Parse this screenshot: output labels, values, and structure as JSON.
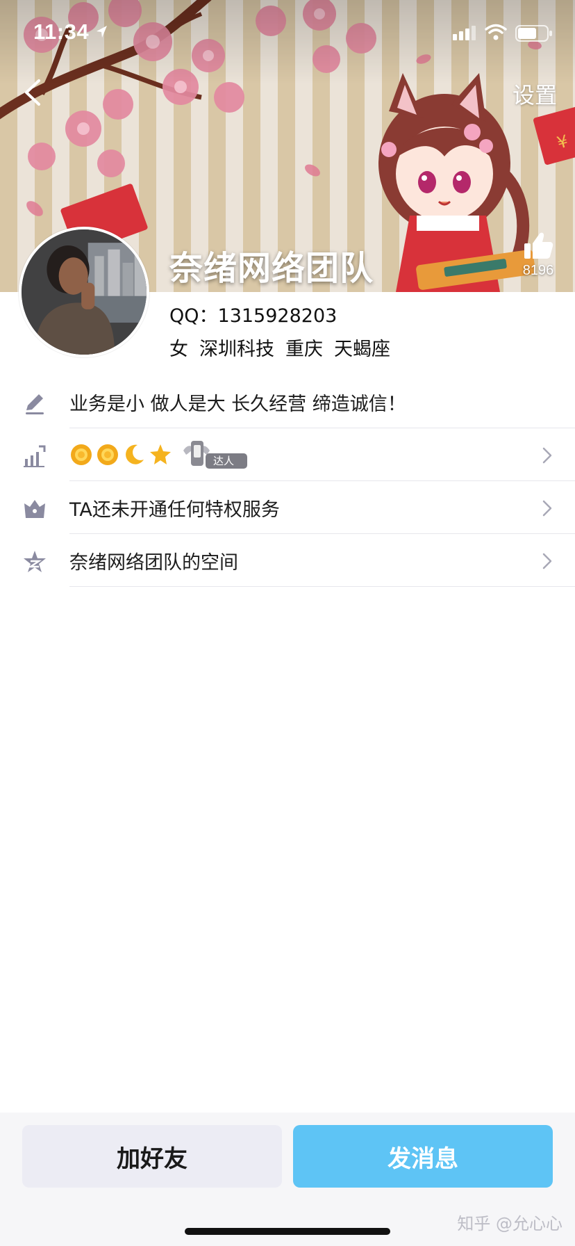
{
  "status_bar": {
    "time": "11:34",
    "icons": [
      "location-arrow-icon",
      "cellular-signal-icon",
      "wifi-icon",
      "battery-icon"
    ]
  },
  "nav": {
    "back_icon": "chevron-left-icon",
    "settings_label": "设置"
  },
  "profile": {
    "name": "奈绪网络团队",
    "like_count": "8196",
    "qq_label": "QQ：",
    "qq_number": "1315928203",
    "tags": [
      "女",
      "深圳科技",
      "重庆",
      "天蝎座"
    ]
  },
  "rows": [
    {
      "icon": "pencil-icon",
      "text": "业务是小 做人是大 长久经营 缔造诚信！",
      "has_chevron": false
    },
    {
      "icon": "level-chart-icon",
      "level_badges": [
        "sun-icon",
        "sun-icon",
        "moon-icon",
        "star-icon"
      ],
      "badge_label": "达人",
      "has_chevron": true
    },
    {
      "icon": "crown-icon",
      "text": "TA还未开通任何特权服务",
      "has_chevron": true
    },
    {
      "icon": "qzone-star-icon",
      "text": "奈绪网络团队的空间",
      "has_chevron": true
    }
  ],
  "buttons": {
    "add_friend": "加好友",
    "send_message": "发消息"
  },
  "watermark": "知乎 @允心心",
  "colors": {
    "accent_blue": "#5ec4f5",
    "secondary_button": "#ececf4",
    "icon_gray": "#8a8aa0"
  }
}
